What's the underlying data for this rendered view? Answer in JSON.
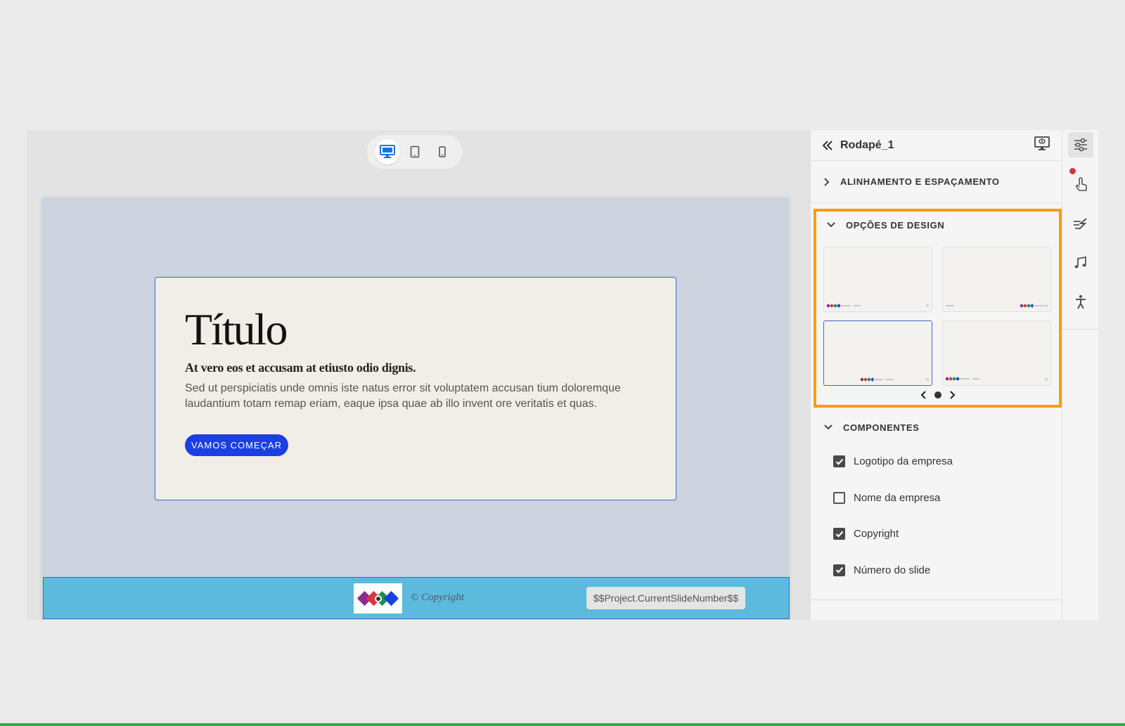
{
  "device_bar": {
    "options": [
      "desktop",
      "tablet",
      "mobile"
    ],
    "selected": "desktop"
  },
  "slide": {
    "title": "Título",
    "subtitle": "At vero eos et accusam at etiusto odio dignis.",
    "body": "Sed ut perspiciatis unde omnis iste natus error sit voluptatem accusan tium doloremque laudantium totam remap eriam, eaque ipsa quae ab illo invent ore veritatis et quas.",
    "button_label": "VAMOS COMEÇAR",
    "footer": {
      "copyright": "© Copyright",
      "slide_number": "$$Project.CurrentSlideNumber$$"
    }
  },
  "panel": {
    "title": "Rodapé_1",
    "sections": {
      "alignment": "ALINHAMENTO E ESPAÇAMENTO",
      "design": "OPÇÕES DE DESIGN",
      "components": "COMPONENTES"
    },
    "design_options": {
      "selected_index": 2,
      "page_count": 1,
      "current_page": 1
    },
    "components": [
      {
        "label": "Logotipo da empresa",
        "checked": true
      },
      {
        "label": "Nome da empresa",
        "checked": false
      },
      {
        "label": "Copyright",
        "checked": true
      },
      {
        "label": "Número do slide",
        "checked": true
      }
    ]
  },
  "rail": {
    "icons": [
      "properties-icon",
      "interaction-icon",
      "animation-icon",
      "audio-icon",
      "accessibility-icon"
    ],
    "active": "properties-icon"
  },
  "colors": {
    "accent_highlight": "#f59e12",
    "footer_bg": "#5cbadd",
    "button_bg": "#1b3fe0",
    "selection_blue": "#3c69c8",
    "notification": "#d7373f"
  }
}
